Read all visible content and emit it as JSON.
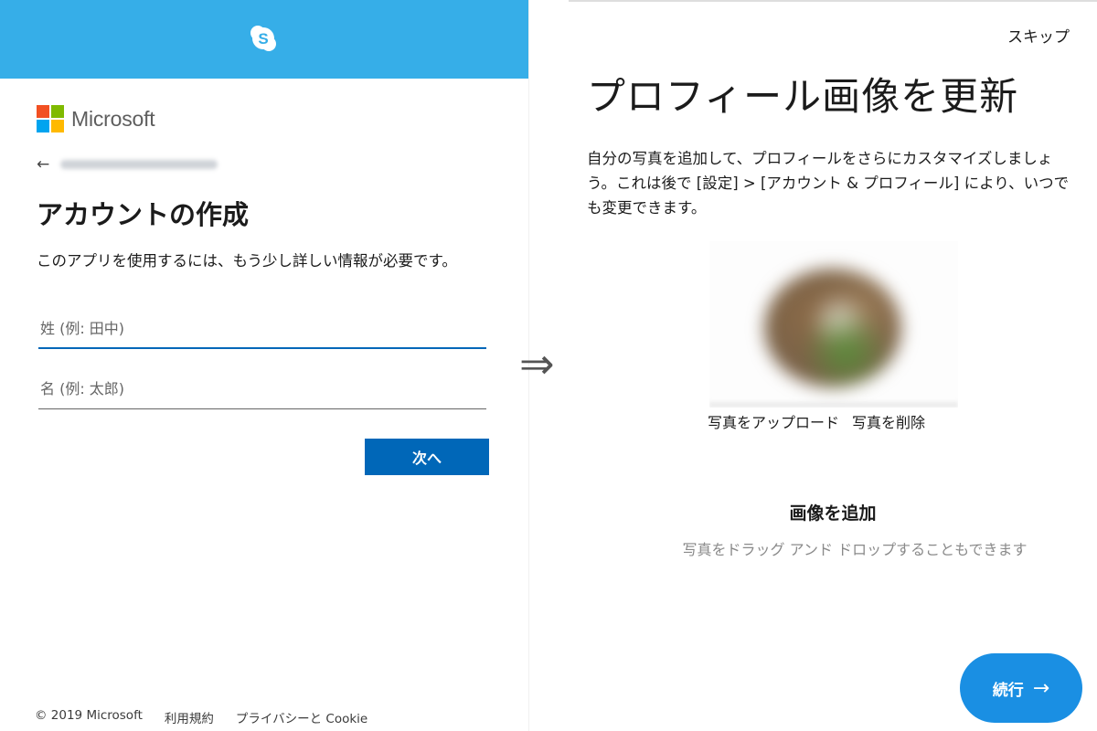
{
  "left": {
    "header_icon": "skype-logo-icon",
    "brand": {
      "name": "Microsoft",
      "colors": [
        "#f25022",
        "#7fba00",
        "#00a4ef",
        "#ffb900"
      ]
    },
    "back_icon": "←",
    "title": "アカウントの作成",
    "description": "このアプリを使用するには、もう少し詳しい情報が必要です。",
    "fields": {
      "last_name_placeholder": "姓 (例: 田中)",
      "first_name_placeholder": "名 (例: 太郎)"
    },
    "next_label": "次へ",
    "footer": {
      "copyright": "© 2019 Microsoft",
      "terms": "利用規約",
      "privacy": "プライバシーと Cookie"
    }
  },
  "transition_arrow": "⇒",
  "right": {
    "skip_label": "スキップ",
    "title": "プロフィール画像を更新",
    "description": "自分の写真を追加して、プロフィールをさらにカスタマイズしましょう。これは後で [設定] > [アカウント & プロフィール] により、いつでも変更できます。",
    "upload_label": "写真をアップロード",
    "remove_label": "写真を削除",
    "add_image_title": "画像を追加",
    "drag_hint": "写真をドラッグ アンド ドロップすることもできます",
    "continue_label": "続行",
    "continue_icon": "→"
  },
  "colors": {
    "skype_blue": "#36aee8",
    "microsoft_blue": "#0067b8",
    "continue_blue": "#1a8fe3"
  }
}
